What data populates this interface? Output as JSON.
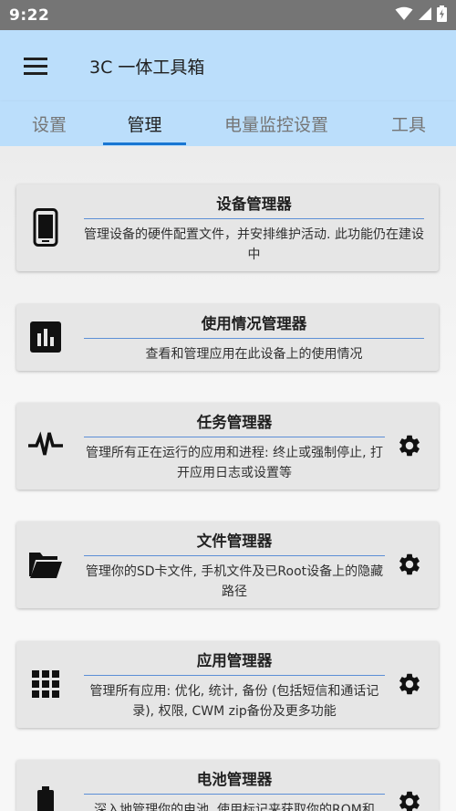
{
  "status_bar": {
    "time": "9:22"
  },
  "app_bar": {
    "title": "3C 一体工具箱"
  },
  "tabs": [
    {
      "label": "设置"
    },
    {
      "label": "管理"
    },
    {
      "label": "电量监控设置"
    },
    {
      "label": "工具"
    }
  ],
  "active_tab": "管理",
  "accent_color": "#1976d2",
  "app_bar_color": "#bbdefb",
  "cards": [
    {
      "icon": "phone-icon",
      "title": "设备管理器",
      "description": "管理设备的硬件配置文件，并安排维护活动. 此功能仍在建设中",
      "has_settings": false
    },
    {
      "icon": "bar-chart-icon",
      "title": "使用情况管理器",
      "description": "查看和管理应用在此设备上的使用情况",
      "has_settings": false
    },
    {
      "icon": "pulse-icon",
      "title": "任务管理器",
      "description": "管理所有正在运行的应用和进程: 终止或强制停止, 打开应用日志或设置等",
      "has_settings": true
    },
    {
      "icon": "folder-open-icon",
      "title": "文件管理器",
      "description": "管理你的SD卡文件, 手机文件及已Root设备上的隐藏路径",
      "has_settings": true
    },
    {
      "icon": "apps-grid-icon",
      "title": "应用管理器",
      "description": "管理所有应用: 优化, 统计, 备份 (包括短信和通话记录), 权限, CWM zip备份及更多功能",
      "has_settings": true
    },
    {
      "icon": "battery-icon",
      "title": "电池管理器",
      "description": "深入地管理你的电池, 使用标记来获取你的ROM和",
      "has_settings": true
    }
  ]
}
